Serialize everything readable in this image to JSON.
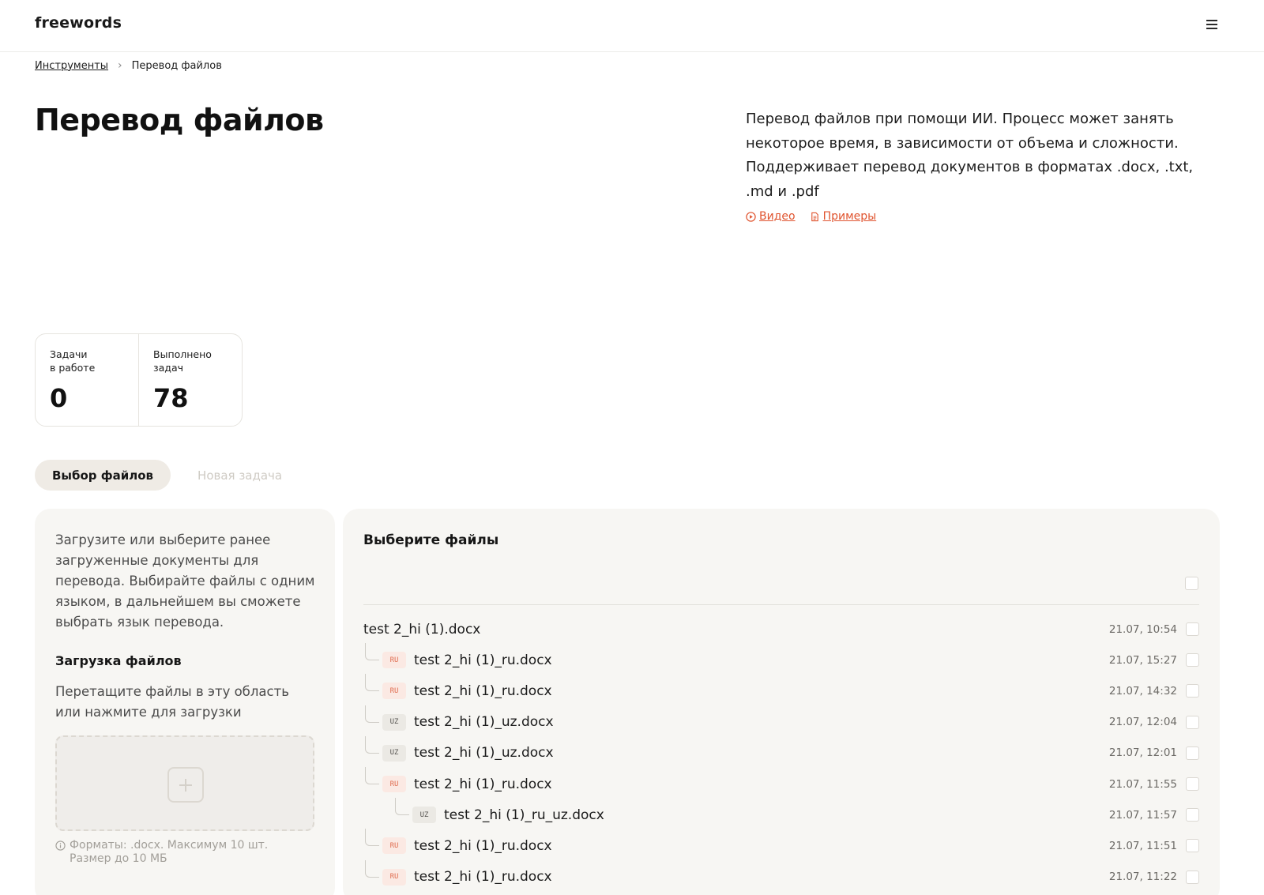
{
  "header": {
    "logo": "freewords",
    "menu_icon": "hamburger-menu-icon"
  },
  "breadcrumb": {
    "root": "Инструменты",
    "current": "Перевод файлов"
  },
  "page": {
    "title": "Перевод файлов",
    "description": "Перевод файлов при помощи ИИ. Процесс может занять некоторое время, в зависимости от объема и сложности. Поддерживает перевод документов в форматах .docx, .txt, .md и .pdf",
    "links": {
      "video": "Видео",
      "examples": "Примеры"
    },
    "accent_color": "#e0542f"
  },
  "stats": {
    "in_progress_label": "Задачи\nв работе",
    "in_progress_value": "0",
    "done_label": "Выполнено\nзадач",
    "done_value": "78"
  },
  "tabs": {
    "select_files": "Выбор файлов",
    "new_task": "Новая задача"
  },
  "left_panel": {
    "intro": "Загрузите или выберите ранее загруженные документы для перевода. Выбирайте файлы с одним языком, в дальнейшем вы сможете выбрать язык перевода.",
    "upload_heading": "Загрузка файлов",
    "upload_hint": "Перетащите файлы в эту область или нажмите для загрузки",
    "formats_line1": "Форматы: .docx. Максимум 10 шт.",
    "formats_line2": "Размер до 10 МБ"
  },
  "right_panel": {
    "heading": "Выберите файлы",
    "files": [
      {
        "name": "test 2_hi (1).docx",
        "date": "21.07, 10:54",
        "lang": "",
        "level": 0
      },
      {
        "name": "test 2_hi (1)_ru.docx",
        "date": "21.07, 15:27",
        "lang": "RU",
        "level": 1
      },
      {
        "name": "test 2_hi (1)_ru.docx",
        "date": "21.07, 14:32",
        "lang": "RU",
        "level": 1
      },
      {
        "name": "test 2_hi (1)_uz.docx",
        "date": "21.07, 12:04",
        "lang": "UZ",
        "level": 1
      },
      {
        "name": "test 2_hi (1)_uz.docx",
        "date": "21.07, 12:01",
        "lang": "UZ",
        "level": 1
      },
      {
        "name": "test 2_hi (1)_ru.docx",
        "date": "21.07, 11:55",
        "lang": "RU",
        "level": 1
      },
      {
        "name": "test 2_hi (1)_ru_uz.docx",
        "date": "21.07, 11:57",
        "lang": "UZ",
        "level": 2
      },
      {
        "name": "test 2_hi (1)_ru.docx",
        "date": "21.07, 11:51",
        "lang": "RU",
        "level": 1
      },
      {
        "name": "test 2_hi (1)_ru.docx",
        "date": "21.07, 11:22",
        "lang": "RU",
        "level": 1
      }
    ]
  }
}
